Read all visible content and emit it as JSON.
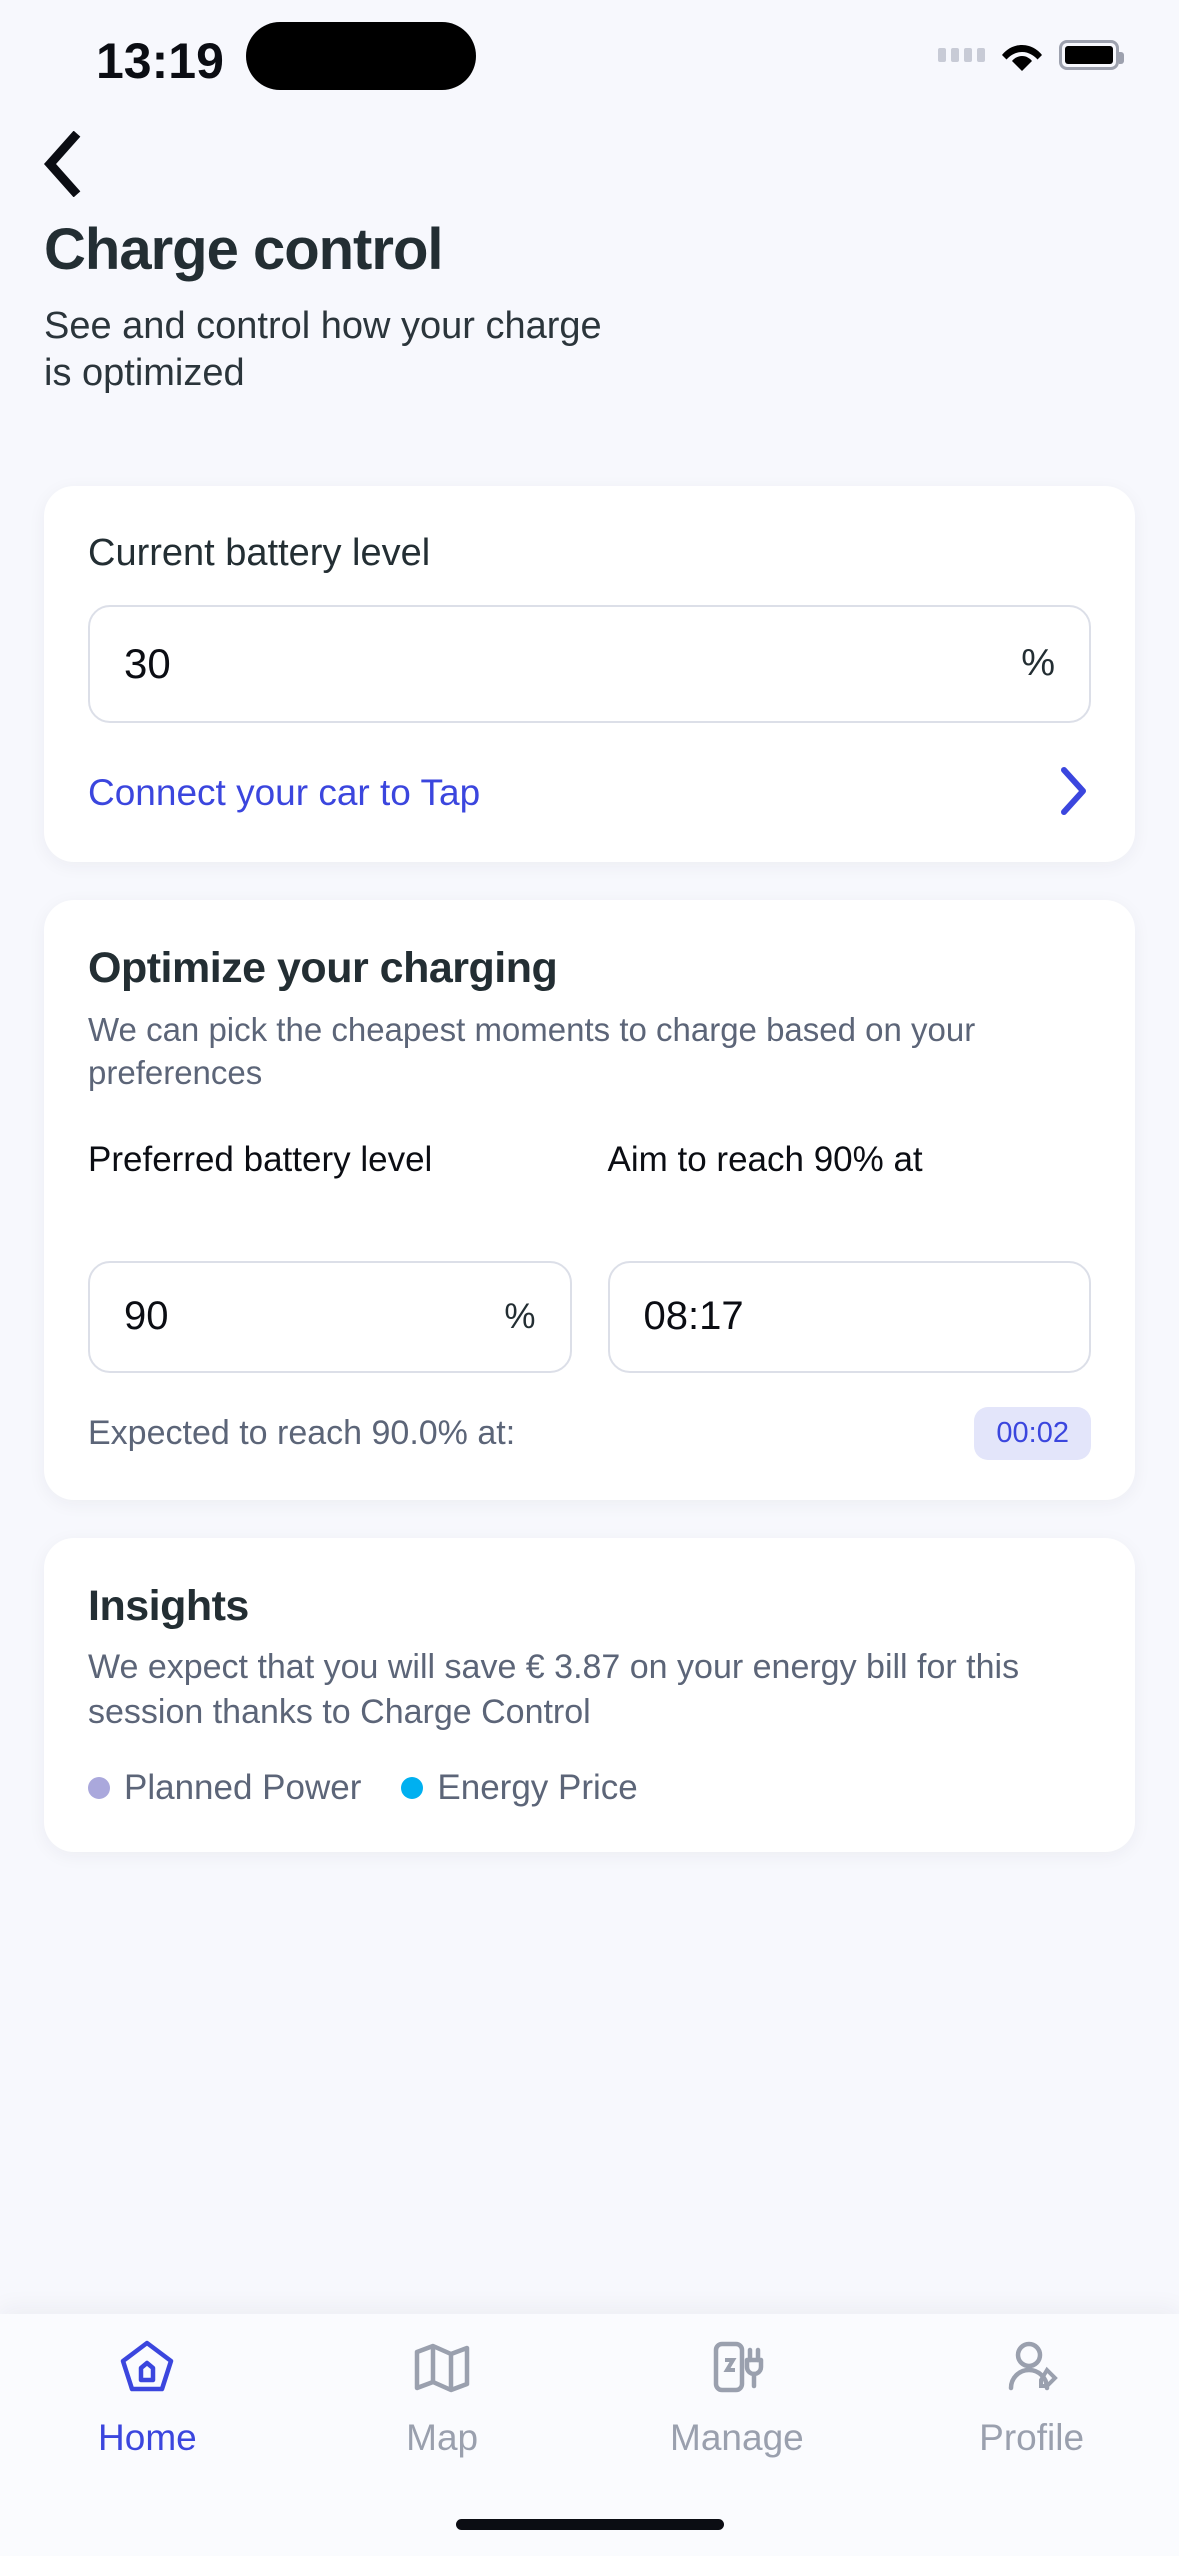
{
  "status_bar": {
    "time": "13:19",
    "signal_icon": "signal-dots-icon",
    "wifi_icon": "wifi-icon",
    "battery_icon": "battery-full-icon"
  },
  "nav": {
    "back_icon": "chevron-left-icon"
  },
  "header": {
    "title": "Charge control",
    "subtitle": "See and control how your charge is optimized"
  },
  "battery_card": {
    "label": "Current battery level",
    "value": "30",
    "unit": "%",
    "link_text": "Connect your car to Tap",
    "link_chevron_icon": "chevron-right-icon",
    "link_color": "#3B46DE"
  },
  "optimize_card": {
    "title": "Optimize your charging",
    "description": "We can pick the cheapest moments to charge based on your preferences",
    "preferred_label": "Preferred battery level",
    "preferred_value": "90",
    "preferred_unit": "%",
    "aim_label": "Aim to reach 90% at",
    "aim_value": "08:17",
    "expected_text": "Expected to reach 90.0% at:",
    "expected_badge": "00:02",
    "badge_bg": "#E3E5FA",
    "badge_color": "#3B46DE"
  },
  "insights_card": {
    "title": "Insights",
    "description": "We expect that you will save € 3.87 on your energy bill for this session thanks to Charge Control",
    "legend": [
      {
        "label": "Planned Power",
        "color": "#AAA8DC"
      },
      {
        "label": "Energy Price",
        "color": "#00B0F0"
      }
    ]
  },
  "bottom_nav": {
    "active_color": "#3B46DE",
    "inactive_color": "#9AA0AE",
    "items": [
      {
        "label": "Home",
        "icon": "home-pentagon-icon",
        "active": true
      },
      {
        "label": "Map",
        "icon": "map-icon",
        "active": false
      },
      {
        "label": "Manage",
        "icon": "charger-plug-icon",
        "active": false
      },
      {
        "label": "Profile",
        "icon": "profile-edit-icon",
        "active": false
      }
    ]
  }
}
